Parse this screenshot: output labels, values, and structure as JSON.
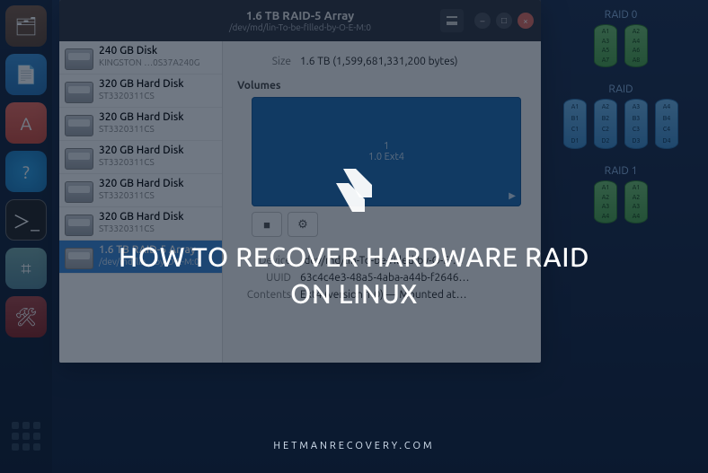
{
  "overlay": {
    "title": "HOW TO RECOVER HARDWARE RAID ON LINUX",
    "site": "HETMANRECOVERY.COM"
  },
  "window": {
    "title": "1.6 TB RAID-5 Array",
    "subtitle": "/dev/md/lin-To-be-filled-by-O-E-M:0"
  },
  "disks": [
    {
      "name": "240 GB Disk",
      "sub": "KINGSTON …0S37A240G"
    },
    {
      "name": "320 GB Hard Disk",
      "sub": "ST3320311CS"
    },
    {
      "name": "320 GB Hard Disk",
      "sub": "ST3320311CS"
    },
    {
      "name": "320 GB Hard Disk",
      "sub": "ST3320311CS"
    },
    {
      "name": "320 GB Hard Disk",
      "sub": "ST3320311CS"
    },
    {
      "name": "320 GB Hard Disk",
      "sub": "ST3320311CS"
    },
    {
      "name": "1.6 TB RAID-5 Array",
      "sub": "/dev/md/lin…by-O-E-M:0"
    }
  ],
  "detail": {
    "size_label": "Size",
    "size_value": "1.6 TB (1,599,681,331,200 bytes)",
    "volumes_heading": "Volumes",
    "volume": {
      "partnum": "1",
      "fs": "1.0 Ext4"
    },
    "device_label": "Device",
    "device_value": "/dev/md/lin-To-be-filled-by-O-E-…",
    "uuid_label": "UUID",
    "uuid_value": "63c4c4e3-48a5-4aba-a44b-f2646…",
    "contents_label": "Contents",
    "contents_value": "Ext4 (version 1.0) — Mounted at…"
  },
  "diagrams": {
    "raid0": {
      "label": "RAID 0",
      "col1": [
        "A1",
        "A3",
        "A5",
        "A7"
      ],
      "col2": [
        "A2",
        "A4",
        "A6",
        "A8"
      ]
    },
    "raid": {
      "label": "RAID",
      "cols": [
        [
          "A1",
          "B1",
          "C1",
          "D1"
        ],
        [
          "A2",
          "B2",
          "C2",
          "D2"
        ],
        [
          "A3",
          "B3",
          "C3",
          "D3"
        ],
        [
          "A4",
          "B4",
          "C4",
          "D4"
        ]
      ]
    },
    "raid1": {
      "label": "RAID 1",
      "col1": [
        "A1",
        "A2",
        "A3",
        "A4"
      ],
      "col2": [
        "A1",
        "A2",
        "A3",
        "A4"
      ]
    }
  },
  "dock": {
    "icons": [
      "files",
      "writer",
      "software",
      "help",
      "terminal",
      "disks",
      "settings"
    ]
  }
}
